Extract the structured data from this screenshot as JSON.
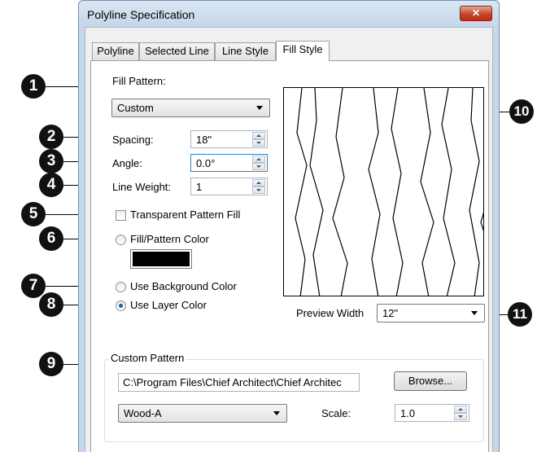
{
  "window": {
    "title": "Polyline Specification",
    "close_symbol": "✕"
  },
  "tabs": [
    {
      "label": "Polyline",
      "active": false
    },
    {
      "label": "Selected Line",
      "active": false
    },
    {
      "label": "Line Style",
      "active": false
    },
    {
      "label": "Fill Style",
      "active": true
    }
  ],
  "fill_style": {
    "fill_pattern_label": "Fill Pattern:",
    "fill_pattern_value": "Custom",
    "spacing_label": "Spacing:",
    "spacing_value": "18\"",
    "angle_label": "Angle:",
    "angle_value": "0.0°",
    "line_weight_label": "Line Weight:",
    "line_weight_value": "1",
    "transparent_label": "Transparent Pattern Fill",
    "transparent_checked": false,
    "fill_color_label": "Fill/Pattern Color",
    "fill_color": "#000000",
    "background_color_label": "Use Background Color",
    "layer_color_label": "Use Layer Color",
    "selected_color_option": "Use Layer Color",
    "preview_width_label": "Preview Width",
    "preview_width_value": "12\""
  },
  "custom_pattern": {
    "group_label": "Custom Pattern",
    "path_value": "C:\\Program Files\\Chief Architect\\Chief Architec",
    "browse_label": "Browse...",
    "pattern_value": "Wood-A",
    "scale_label": "Scale:",
    "scale_value": "1.0"
  },
  "callouts": [
    "1",
    "2",
    "3",
    "4",
    "5",
    "6",
    "7",
    "8",
    "9",
    "10",
    "11"
  ]
}
